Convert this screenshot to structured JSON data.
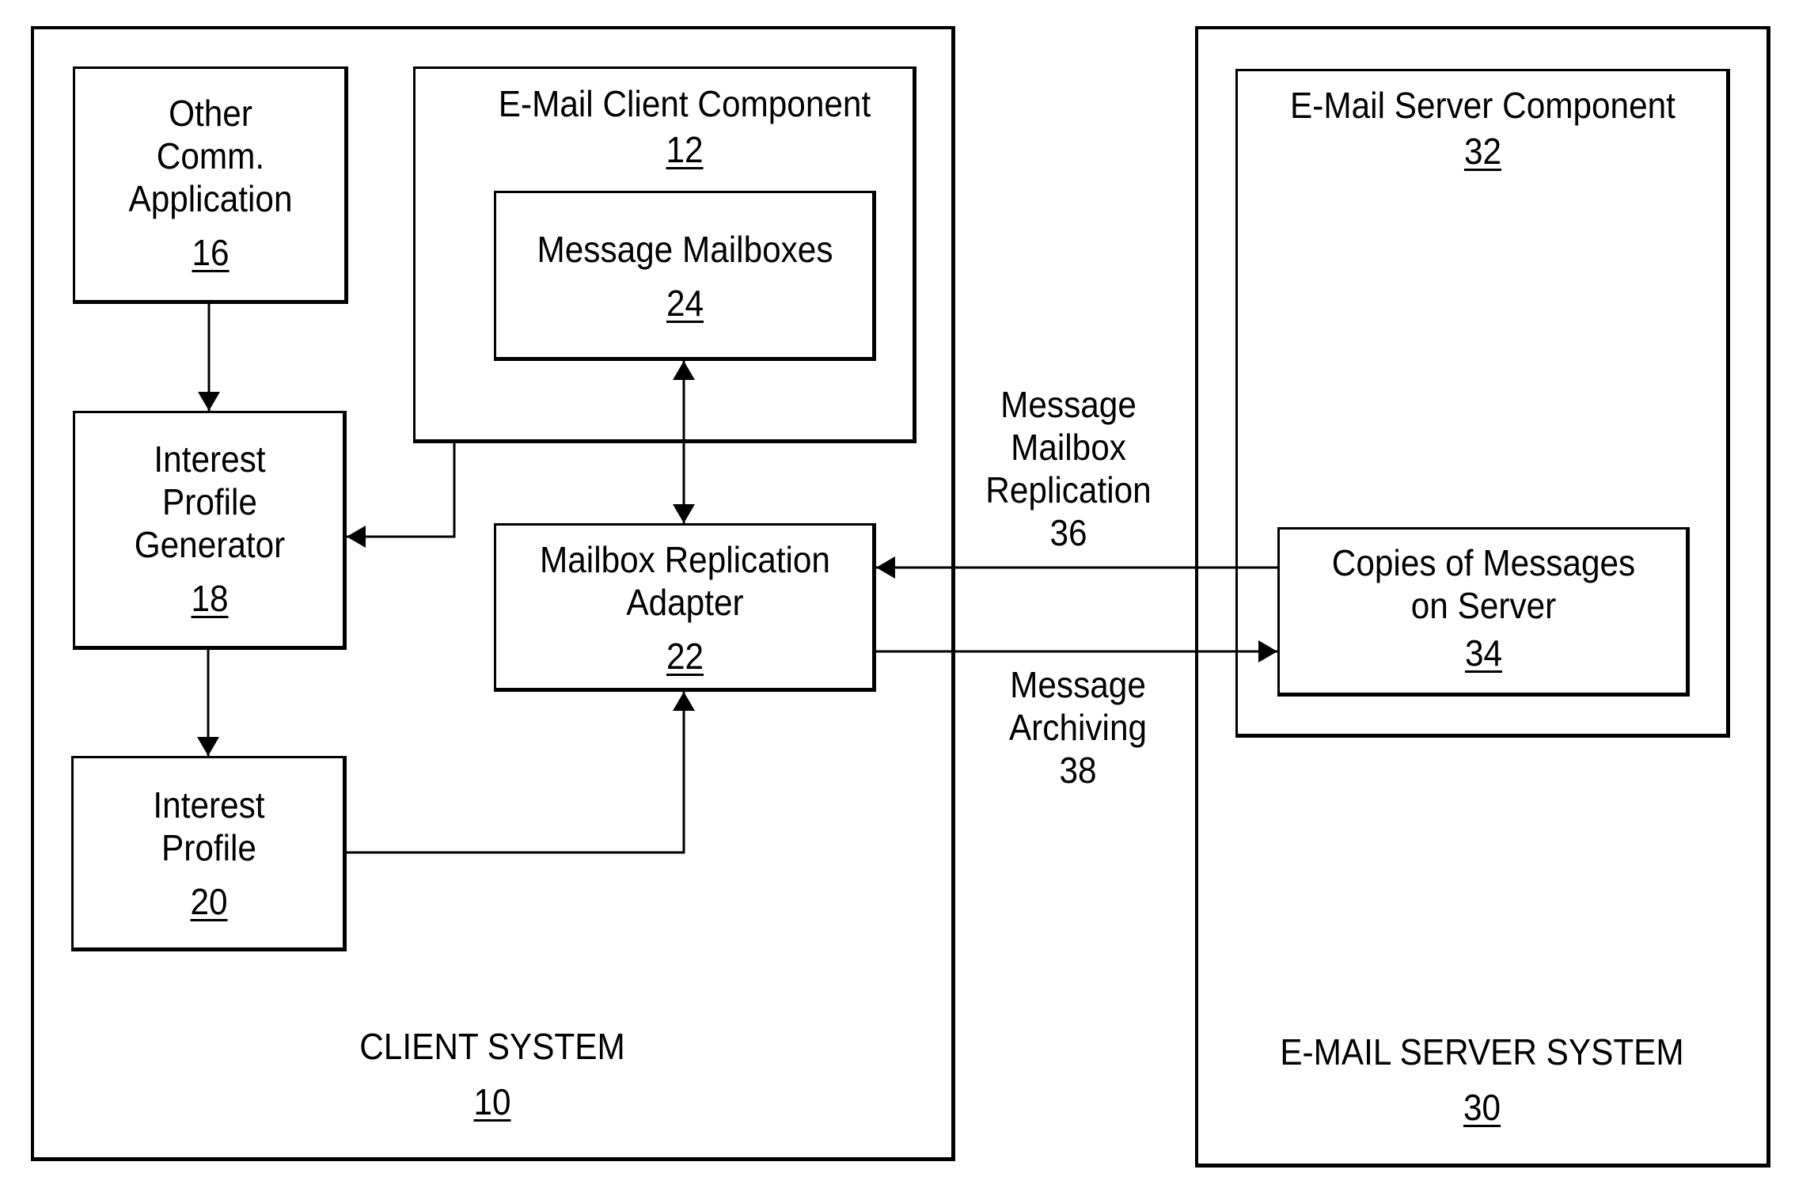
{
  "client_system": {
    "title": "CLIENT SYSTEM",
    "ref": "10",
    "components": {
      "other_comm_app": {
        "lines": [
          "Other",
          "Comm.",
          "Application"
        ],
        "ref": "16"
      },
      "email_client_component": {
        "title": "E-Mail Client Component",
        "ref": "12"
      },
      "message_mailboxes": {
        "title": "Message Mailboxes",
        "ref": "24"
      },
      "interest_profile_generator": {
        "lines": [
          "Interest",
          "Profile",
          "Generator"
        ],
        "ref": "18"
      },
      "mailbox_replication_adapter": {
        "lines": [
          "Mailbox Replication",
          "Adapter"
        ],
        "ref": "22"
      },
      "interest_profile": {
        "lines": [
          "Interest",
          "Profile"
        ],
        "ref": "20"
      }
    }
  },
  "server_system": {
    "title": "E-MAIL SERVER SYSTEM",
    "ref": "30",
    "components": {
      "email_server_component": {
        "title": "E-Mail Server Component",
        "ref": "32"
      },
      "copies_on_server": {
        "lines": [
          "Copies of Messages",
          "on Server"
        ],
        "ref": "34"
      }
    }
  },
  "flows": {
    "replication": {
      "lines": [
        "Message",
        "Mailbox",
        "Replication"
      ],
      "ref": "36"
    },
    "archiving": {
      "lines": [
        "Message",
        "Archiving"
      ],
      "ref": "38"
    }
  },
  "connections": [
    {
      "from": "Other Comm. Application",
      "to": "Interest Profile Generator",
      "type": "arrow"
    },
    {
      "from": "E-Mail Client Component",
      "to": "Interest Profile Generator",
      "type": "arrow"
    },
    {
      "from": "Interest Profile Generator",
      "to": "Interest Profile",
      "type": "arrow"
    },
    {
      "from": "Message Mailboxes",
      "to": "Mailbox Replication Adapter",
      "type": "bidirectional"
    },
    {
      "from": "Interest Profile",
      "to": "Mailbox Replication Adapter",
      "type": "arrow"
    },
    {
      "from": "Copies of Messages on Server",
      "to": "Mailbox Replication Adapter",
      "type": "arrow"
    },
    {
      "from": "Mailbox Replication Adapter",
      "to": "Copies of Messages on Server",
      "type": "arrow"
    }
  ]
}
